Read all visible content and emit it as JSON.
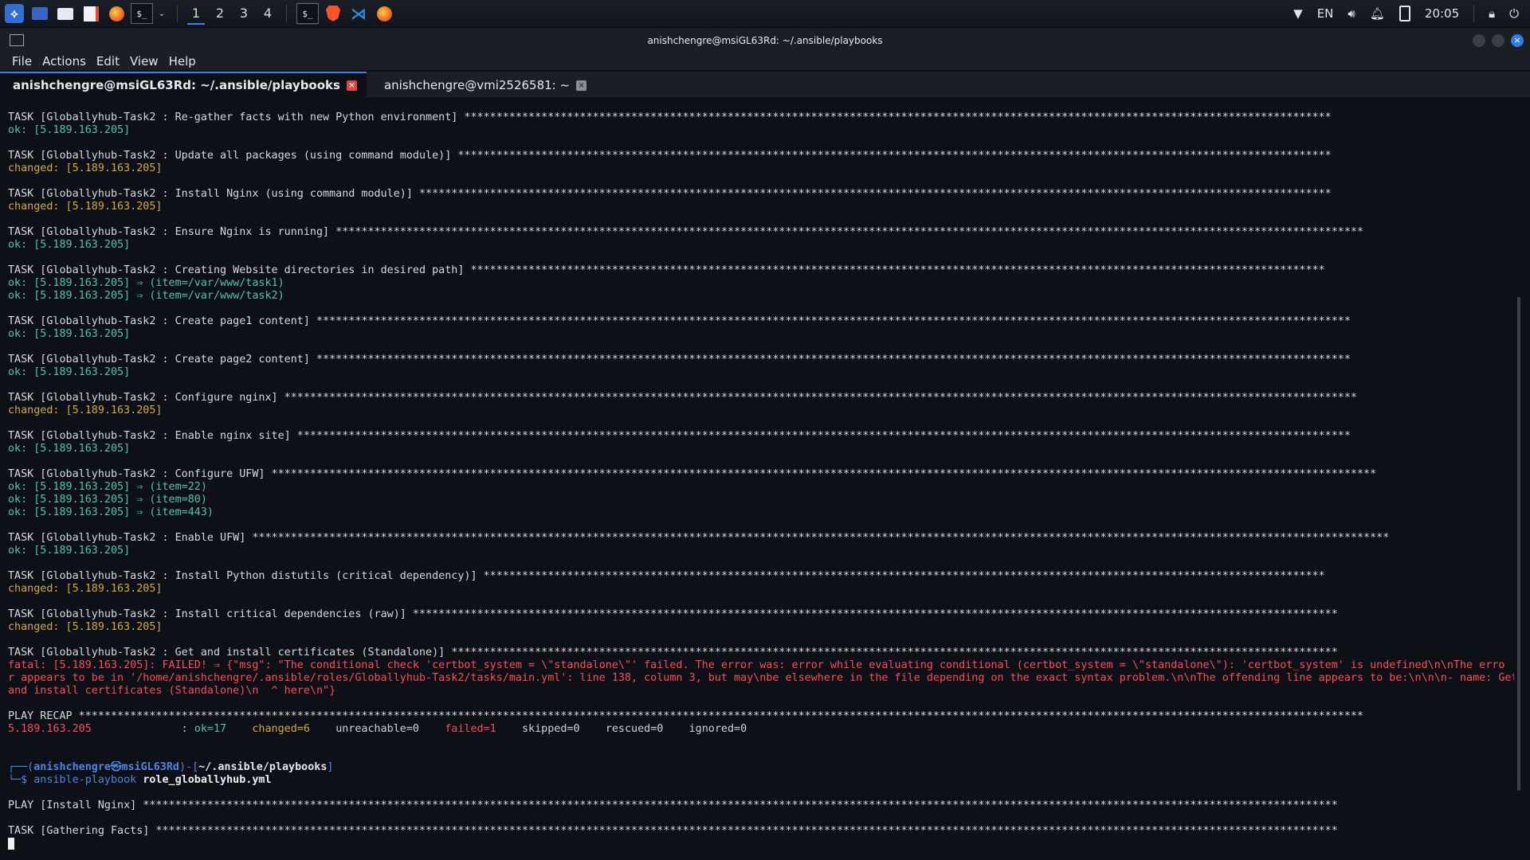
{
  "taskbar": {
    "workspaces": [
      "1",
      "2",
      "3",
      "4"
    ],
    "active_workspace": "1",
    "language": "EN",
    "clock": "20:05",
    "terminal_icon_text": "$_"
  },
  "window": {
    "title": "anishchengre@msiGL63Rd: ~/.ansible/playbooks",
    "menu": [
      "File",
      "Actions",
      "Edit",
      "View",
      "Help"
    ],
    "tabs": [
      {
        "label": "anishchengre@msiGL63Rd: ~/.ansible/playbooks",
        "active": true
      },
      {
        "label": "anishchengre@vmi2526581: ~",
        "active": false
      }
    ],
    "close_glyph": "×"
  },
  "terminal": {
    "lines": [
      {
        "t": "TASK [Globallyhub-Task2 : Re-gather facts with new Python environment] ***************************************************************************************************************************************",
        "c": "tk"
      },
      {
        "t": "ok: [5.189.163.205]",
        "c": "ok"
      },
      {
        "t": "",
        "c": "tk"
      },
      {
        "t": "TASK [Globallyhub-Task2 : Update all packages (using command module)] ****************************************************************************************************************************************",
        "c": "tk"
      },
      {
        "t": "changed: [5.189.163.205]",
        "c": "ch"
      },
      {
        "t": "",
        "c": "tk"
      },
      {
        "t": "TASK [Globallyhub-Task2 : Install Nginx (using command module)] **********************************************************************************************************************************************",
        "c": "tk"
      },
      {
        "t": "changed: [5.189.163.205]",
        "c": "ch"
      },
      {
        "t": "",
        "c": "tk"
      },
      {
        "t": "TASK [Globallyhub-Task2 : Ensure Nginx is running] ****************************************************************************************************************************************************************",
        "c": "tk"
      },
      {
        "t": "ok: [5.189.163.205]",
        "c": "ok"
      },
      {
        "t": "",
        "c": "tk"
      },
      {
        "t": "TASK [Globallyhub-Task2 : Creating Website directories in desired path] *************************************************************************************************************************************",
        "c": "tk"
      },
      {
        "t": "ok: [5.189.163.205] ⇒ (item=/var/www/task1)",
        "c": "ok"
      },
      {
        "t": "ok: [5.189.163.205] ⇒ (item=/var/www/task2)",
        "c": "ok"
      },
      {
        "t": "",
        "c": "tk"
      },
      {
        "t": "TASK [Globallyhub-Task2 : Create page1 content] *****************************************************************************************************************************************************************",
        "c": "tk"
      },
      {
        "t": "ok: [5.189.163.205]",
        "c": "ok"
      },
      {
        "t": "",
        "c": "tk"
      },
      {
        "t": "TASK [Globallyhub-Task2 : Create page2 content] *****************************************************************************************************************************************************************",
        "c": "tk"
      },
      {
        "t": "ok: [5.189.163.205]",
        "c": "ok"
      },
      {
        "t": "",
        "c": "tk"
      },
      {
        "t": "TASK [Globallyhub-Task2 : Configure nginx] ***********************************************************************************************************************************************************************",
        "c": "tk"
      },
      {
        "t": "changed: [5.189.163.205]",
        "c": "ch"
      },
      {
        "t": "",
        "c": "tk"
      },
      {
        "t": "TASK [Globallyhub-Task2 : Enable nginx site] ********************************************************************************************************************************************************************",
        "c": "tk"
      },
      {
        "t": "ok: [5.189.163.205]",
        "c": "ok"
      },
      {
        "t": "",
        "c": "tk"
      },
      {
        "t": "TASK [Globallyhub-Task2 : Configure UFW] ****************************************************************************************************************************************************************************",
        "c": "tk"
      },
      {
        "t": "ok: [5.189.163.205] ⇒ (item=22)",
        "c": "ok"
      },
      {
        "t": "ok: [5.189.163.205] ⇒ (item=80)",
        "c": "ok"
      },
      {
        "t": "ok: [5.189.163.205] ⇒ (item=443)",
        "c": "ok"
      },
      {
        "t": "",
        "c": "tk"
      },
      {
        "t": "TASK [Globallyhub-Task2 : Enable UFW] *********************************************************************************************************************************************************************************",
        "c": "tk"
      },
      {
        "t": "ok: [5.189.163.205]",
        "c": "ok"
      },
      {
        "t": "",
        "c": "tk"
      },
      {
        "t": "TASK [Globallyhub-Task2 : Install Python distutils (critical dependency)] ***********************************************************************************************************************************",
        "c": "tk"
      },
      {
        "t": "changed: [5.189.163.205]",
        "c": "ch"
      },
      {
        "t": "",
        "c": "tk"
      },
      {
        "t": "TASK [Globallyhub-Task2 : Install critical dependencies (raw)] ************************************************************************************************************************************************",
        "c": "tk"
      },
      {
        "t": "changed: [5.189.163.205]",
        "c": "ch"
      },
      {
        "t": "",
        "c": "tk"
      },
      {
        "t": "TASK [Globallyhub-Task2 : Get and install certificates (Standalone)] ******************************************************************************************************************************************",
        "c": "tk"
      },
      {
        "t": "fatal: [5.189.163.205]: FAILED! ⇒ {\"msg\": \"The conditional check 'certbot_system = \\\"standalone\\\"' failed. The error was: error while evaluating conditional (certbot_system = \\\"standalone\\\"): 'certbot_system' is undefined\\n\\nThe erro",
        "c": "fa"
      },
      {
        "t": "r appears to be in '/home/anishchengre/.ansible/roles/Globallyhub-Task2/tasks/main.yml': line 138, column 3, but may\\nbe elsewhere in the file depending on the exact syntax problem.\\n\\nThe offending line appears to be:\\n\\n\\n- name: Get",
        "c": "fa"
      },
      {
        "t": "and install certificates (Standalone)\\n  ^ here\\n\"}",
        "c": "fa"
      },
      {
        "t": "",
        "c": "tk"
      },
      {
        "t": "PLAY RECAP ********************************************************************************************************************************************************************************************************",
        "c": "pl"
      }
    ],
    "recap": {
      "host": "5.189.163.205",
      "ok": "ok=17",
      "changed": "changed=6",
      "unreachable": "unreachable=0",
      "failed": "failed=1",
      "skipped": "skipped=0",
      "rescued": "rescued=0",
      "ignored": "ignored=0"
    },
    "prompt": {
      "open": "┌──(",
      "user_host": "anishchengre㉿msiGL63Rd",
      "mid": ")-[",
      "path": "~/.ansible/playbooks",
      "close": "]",
      "dollar": "└─$ ",
      "command": "ansible-playbook",
      "argument": "role_globallyhub.yml"
    },
    "after_lines": [
      "PLAY [Install Nginx] ******************************************************************************************************************************************************************************************",
      "TASK [Gathering Facts] ****************************************************************************************************************************************************************************************"
    ]
  }
}
